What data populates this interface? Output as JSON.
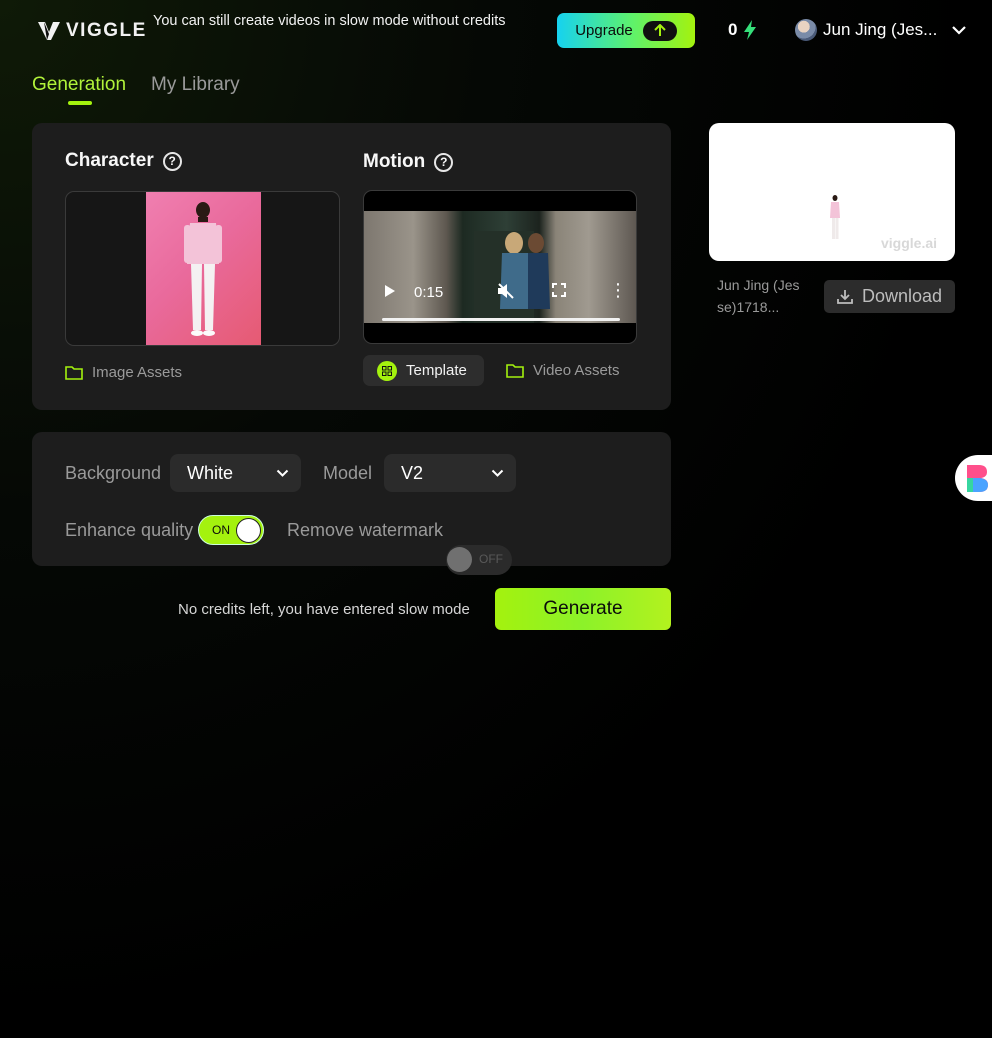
{
  "header": {
    "logo_text": "VIGGLE",
    "notice": "You can still create videos in slow mode without credits",
    "upgrade_label": "Upgrade",
    "credits": "0",
    "user_name": "Jun Jing (Jes..."
  },
  "tabs": {
    "generation": "Generation",
    "library": "My Library"
  },
  "character": {
    "title": "Character",
    "assets_label": "Image Assets"
  },
  "motion": {
    "title": "Motion",
    "time": "0:15",
    "template_label": "Template",
    "assets_label": "Video Assets"
  },
  "options": {
    "background_label": "Background",
    "background_value": "White",
    "model_label": "Model",
    "model_value": "V2",
    "enhance_label": "Enhance quality",
    "enhance_state": "ON",
    "watermark_label": "Remove watermark",
    "watermark_state": "OFF"
  },
  "footer": {
    "message": "No credits left, you have entered slow mode",
    "generate_label": "Generate"
  },
  "preview": {
    "watermark": "viggle.ai",
    "file_name": "Jun Jing (Jesse)1718...",
    "download_label": "Download"
  },
  "colors": {
    "accent": "#a4f20e",
    "panel": "#1d1d1d",
    "muted": "#9a9a9a"
  }
}
